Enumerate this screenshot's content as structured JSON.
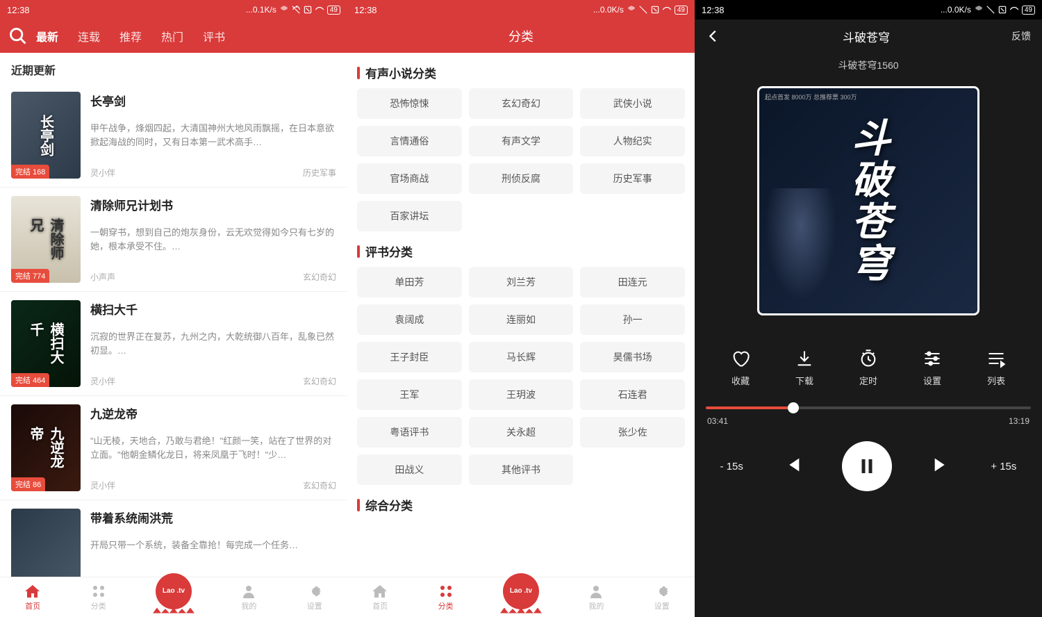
{
  "status": {
    "time": "12:38",
    "net1": "...0.1K/s",
    "net2": "...0.0K/s",
    "net3": "...0.0K/s",
    "battery": "49"
  },
  "screen1": {
    "tabs": [
      "最新",
      "连载",
      "推荐",
      "热门",
      "评书"
    ],
    "section_title": "近期更新",
    "books": [
      {
        "title": "长亭剑",
        "desc": "甲午战争，烽烟四起，大清国神州大地风雨飘摇，在日本意欲掀起海战的同时，又有日本第一武术高手…",
        "author": "灵小伴",
        "category": "历史军事",
        "badge": "完结 168",
        "cover_text": "长亭剑"
      },
      {
        "title": "清除师兄计划书",
        "desc": "一朝穿书，想到自己的炮灰身份，云无欢觉得如今只有七岁的她，根本承受不住。…",
        "author": "小声声",
        "category": "玄幻奇幻",
        "badge": "完结 774",
        "cover_text": "清除师兄"
      },
      {
        "title": "横扫大千",
        "desc": "沉寂的世界正在复苏，九州之内，大乾统御八百年，乱象已然初显。…",
        "author": "灵小伴",
        "category": "玄幻奇幻",
        "badge": "完结 464",
        "cover_text": "横扫大千"
      },
      {
        "title": "九逆龙帝",
        "desc": "\"山无棱，天地合，乃敢与君绝！\"红颜一笑，站在了世界的对立面。\"他朝金鳞化龙日，将来凤凰于飞时！\"少…",
        "author": "灵小伴",
        "category": "玄幻奇幻",
        "badge": "完结 86",
        "cover_text": "九逆龙帝"
      },
      {
        "title": "带着系统闹洪荒",
        "desc": "开局只带一个系统，装备全靠抢！每完成一个任务…",
        "author": "",
        "category": "",
        "badge": "",
        "cover_text": ""
      }
    ]
  },
  "screen2": {
    "header": "分类",
    "sections": [
      {
        "title": "有声小说分类",
        "items": [
          "恐怖惊悚",
          "玄幻奇幻",
          "武侠小说",
          "言情通俗",
          "有声文学",
          "人物纪实",
          "官场商战",
          "刑侦反腐",
          "历史军事",
          "百家讲坛"
        ]
      },
      {
        "title": "评书分类",
        "items": [
          "单田芳",
          "刘兰芳",
          "田连元",
          "袁阔成",
          "连丽如",
          "孙一",
          "王子封臣",
          "马长辉",
          "昊儒书场",
          "王军",
          "王玥波",
          "石连君",
          "粤语评书",
          "关永超",
          "张少佐",
          "田战义",
          "其他评书"
        ]
      },
      {
        "title": "综合分类",
        "items": []
      }
    ]
  },
  "nav": {
    "items": [
      "首页",
      "分类",
      "",
      "我的",
      "设置"
    ],
    "center": "Lao .tv"
  },
  "player": {
    "title": "斗破苍穹",
    "subtitle": "斗破苍穹1560",
    "feedback": "反馈",
    "album_text": "斗破苍穹",
    "album_side": "起点首发 8000万\n总推荐票 300万",
    "actions": [
      {
        "label": "收藏",
        "icon": "heart"
      },
      {
        "label": "下载",
        "icon": "download"
      },
      {
        "label": "定时",
        "icon": "timer"
      },
      {
        "label": "设置",
        "icon": "settings"
      },
      {
        "label": "列表",
        "icon": "list"
      }
    ],
    "time_current": "03:41",
    "time_total": "13:19",
    "skip_back": "- 15s",
    "skip_fwd": "+ 15s"
  }
}
